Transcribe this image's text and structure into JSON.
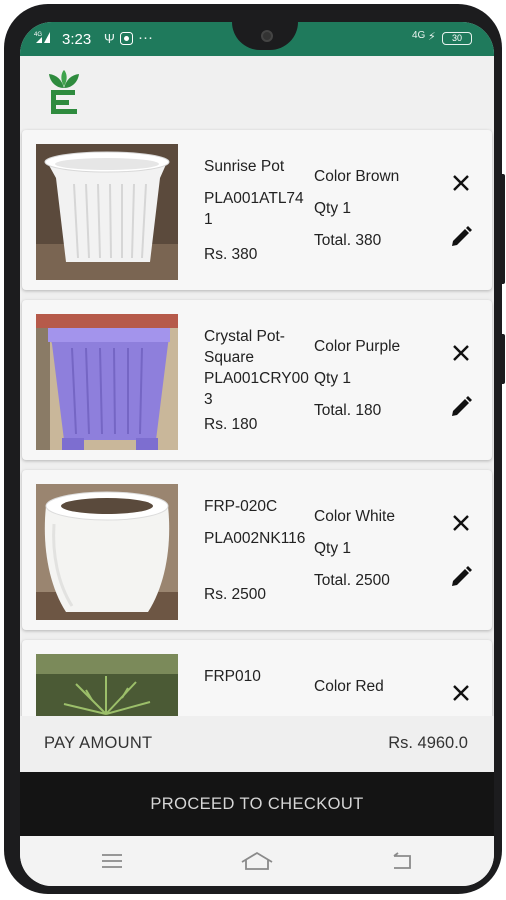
{
  "status_bar": {
    "time": "3:23",
    "left_icons": [
      "signal-icon",
      "usb-icon",
      "app-icon"
    ],
    "more_text": "···",
    "network": "4G",
    "battery": "30"
  },
  "colors": {
    "status_bar": "#1f7a5c",
    "logo_green": "#2e8b3e",
    "checkout_bg": "#141414",
    "nav_bg": "#f3f3f3"
  },
  "cart_items": [
    {
      "name": "Sunrise Pot",
      "code": "PLA001ATL741",
      "price": "Rs. 380",
      "color": "Color Brown",
      "qty": "Qty 1",
      "total": "Total. 380",
      "image": "white-ribbed-pot"
    },
    {
      "name": "Crystal Pot-Square",
      "code": "PLA001CRY003",
      "price": "Rs. 180",
      "color": "Color Purple",
      "qty": "Qty 1",
      "total": "Total. 180",
      "image": "purple-square-pot"
    },
    {
      "name": " FRP-020C",
      "code": "PLA002NK116",
      "price": "Rs. 2500",
      "color": "Color White",
      "qty": "Qty 1",
      "total": "Total. 2500",
      "image": "white-round-pot"
    },
    {
      "name": "FRP010",
      "color": "Color Red",
      "image": "green-plant"
    }
  ],
  "footer": {
    "pay_label": "PAY AMOUNT",
    "pay_amount": "Rs. 4960.0",
    "checkout_label": "PROCEED TO CHECKOUT"
  },
  "nav": [
    "menu-icon",
    "home-icon",
    "back-icon"
  ]
}
